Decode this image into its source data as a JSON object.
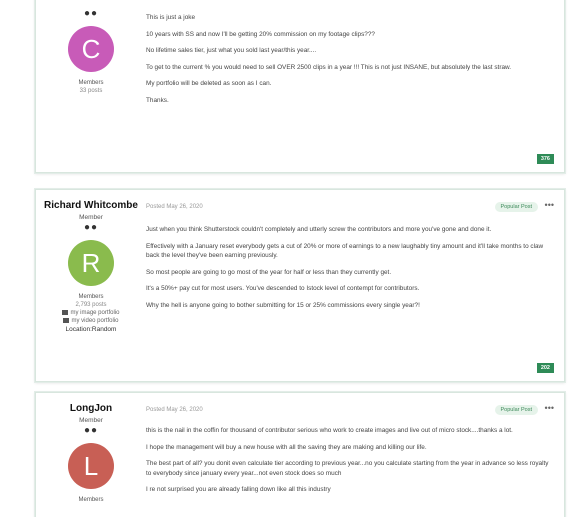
{
  "colors": {
    "green": "#2e8b57",
    "avatar_c": "#c85bb8",
    "avatar_r": "#8abb4d",
    "avatar_l": "#c85f55"
  },
  "posts": [
    {
      "author": {
        "pips": "●●",
        "avatar": "C",
        "group": "Members",
        "count": "33 posts"
      },
      "paragraphs": [
        "This is just a joke",
        "10 years with SS and now I'll be getting 20% commission on my footage clips???",
        "No lifetime sales tier, just what you sold last year/this year....",
        "To get to the current % you would need to sell OVER 2500 clips in a year !!! This is not just INSANE, but absolutely the last straw.",
        "My portfolio will be deleted as soon as I can.",
        "Thanks."
      ],
      "reputation": "376"
    },
    {
      "author": {
        "name": "Richard Whitcombe",
        "title": "Member",
        "pips": "●●",
        "avatar": "R",
        "group": "Members",
        "count": "2,793 posts",
        "link1": "my image portfolio",
        "link2": "my video portfolio",
        "location": "Location:Random"
      },
      "date": "Posted May 26, 2020",
      "badge": "Popular Post",
      "more": "•••",
      "paragraphs": [
        "Just when you think Shutterstock couldn't completely and utterly screw the contributors and more you've gone and done it.",
        "Effectively with a January reset everybody gets a cut of 20% or more of earnings to a new laughably tiny amount and it'll take months to claw back the level they've been earning previously.",
        "So most people are going to go most of the year for half or less than they currently get.",
        "It's a 50%+ pay cut for most users.  You've descended to Istock level of contempt for contributors.",
        "Why the hell is anyone going to bother submitting for 15 or 25% commissions every single year?!"
      ],
      "reputation": "202"
    },
    {
      "author": {
        "name": "LongJon",
        "title": "Member",
        "pips": "●●",
        "avatar": "L",
        "group": "Members"
      },
      "date": "Posted May 26, 2020",
      "badge": "Popular Post",
      "more": "•••",
      "paragraphs": [
        "this is the nail in the coffin for thousand of contributor serious who work to create images and live out of micro stock....thanks a lot.",
        "I hope the management will buy a new house with all the saving they are making and killing our life.",
        "The best part of all? you donit even calculate tier according to previous year...no you calculate starting from the year in advance so less royalty to everybody since january every year...not even stock does so much",
        "I re not surprised you are already falling down like all this industry"
      ]
    }
  ]
}
